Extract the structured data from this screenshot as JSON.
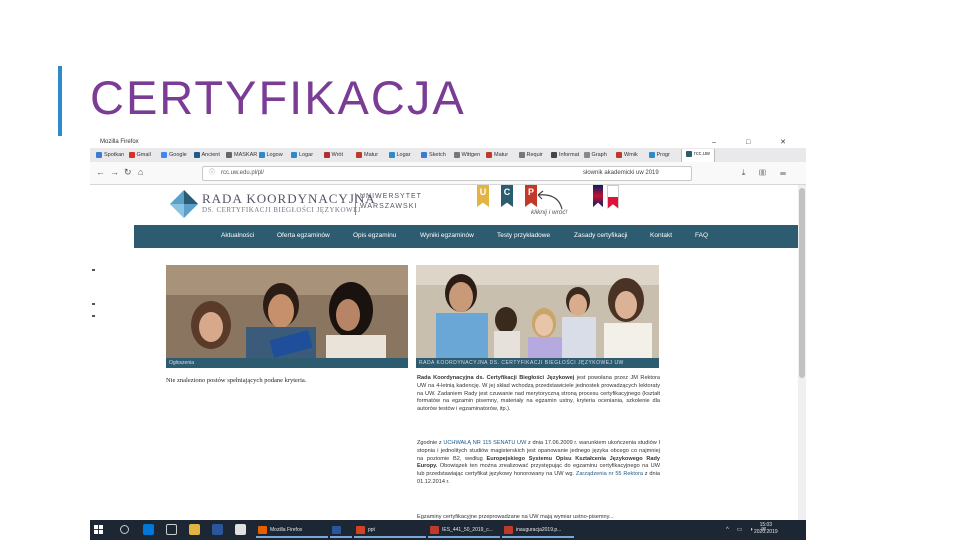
{
  "slide": {
    "title": "CERTYFIKACJA"
  },
  "window": {
    "title": "Mozilla Firefox",
    "controls": "–  □  ✕"
  },
  "tabs": [
    {
      "label": "Spotkan",
      "color": "#3a7bd5"
    },
    {
      "label": "Gmail",
      "color": "#d93025"
    },
    {
      "label": "Google",
      "color": "#4285f4"
    },
    {
      "label": "Ancient",
      "color": "#1e5a8a"
    },
    {
      "label": "MASKAR",
      "color": "#666666"
    },
    {
      "label": "Logow",
      "color": "#2e8bc9"
    },
    {
      "label": "Logar",
      "color": "#2e8bc9"
    },
    {
      "label": "Wrót",
      "color": "#b03030"
    },
    {
      "label": "Matur",
      "color": "#c0392b"
    },
    {
      "label": "Logar",
      "color": "#2e8bc9"
    },
    {
      "label": "Sketch",
      "color": "#3a7bd5"
    },
    {
      "label": "Wittgen",
      "color": "#777777"
    },
    {
      "label": "Matur",
      "color": "#c0392b"
    },
    {
      "label": "Requir",
      "color": "#777777"
    },
    {
      "label": "Informat",
      "color": "#444444"
    },
    {
      "label": "Graph",
      "color": "#888888"
    },
    {
      "label": "Wmik",
      "color": "#c0392b"
    },
    {
      "label": "Progr",
      "color": "#2e8bc9"
    },
    {
      "label": "rcc.uw",
      "color": "#2d5b70"
    }
  ],
  "urlbar": {
    "url": "rcc.uw.edu.pl/pl/",
    "search": "słownik akademicki uw 2019"
  },
  "site": {
    "logo_line1": "RADA KOORDYNACYJNA",
    "logo_line2": "DS. CERTYFIKACJI BIEGŁOŚCI JĘZYKOWEJ",
    "uw_line1": "UNIWERSYTET",
    "uw_line2": "WARSZAWSKI",
    "bookmarks": [
      {
        "letter": "U",
        "color": "#e2b441"
      },
      {
        "letter": "C",
        "color": "#2d5b70"
      },
      {
        "letter": "P",
        "color": "#c0392b"
      }
    ],
    "handwritten": "kliknij i wróć!",
    "nav": [
      "Aktualności",
      "Oferta egzaminów",
      "Opis egzaminu",
      "Wyniki egzaminów",
      "Testy przykładowe",
      "Zasady certyfikacji",
      "Kontakt",
      "FAQ"
    ],
    "caption_left": "Ogłoszenia",
    "caption_right": "RADA KOORDYNACYJNA DS. CERTYFIKACJI BIEGŁOŚCI JĘZYKOWEJ UW",
    "no_results": "Nie znaleziono postów spełniających podane kryteria.",
    "para1_bold": "Rada Koordynacyjna ds. Certyfikacji Biegłości Językowej",
    "para1_rest": " jest powołana przez JM Rektora UW na 4-letnią kadencję. W jej skład wchodzą przedstawiciele jednostek prowadzących lektoraty na UW. Zadaniem Rady jest czuwanie nad merytoryczną stroną procesu certyfikacyjnego (kształt formatów na egzamin pisemny, materiały na egzamin ustny, kryteria oceniania, szkolenie dla autorów testów i egzaminatorów, itp.).",
    "para2_a": "Zgodnie z ",
    "para2_link": "UCHWAŁĄ NR 115 SENATU UW",
    "para2_b": " z dnia 17.06.2009 r. warunkiem ukończenia studiów I stopnia i jednolitych studiów magisterskich jest opanowanie jednego języka obcego co najmniej na poziomie B2, według ",
    "para2_bold": "Europejskiego Systemu Opisu Kształcenia Językowego Rady Europy.",
    "para2_c": " Obowiązek ten można zrealizować przystępując do egzaminu certyfikacyjnego na UW lub przedstawiając certyfikat językowy honorowany na UW wg. ",
    "para2_link2": "Zarządzenia nr 55 Rektora",
    "para2_d": " z dnia 01.12.2014 r.",
    "para3": "Egzaminy certyfikacyjne przeprowadzane na UW mają wymiar ustno-pisemny..."
  },
  "taskbar": {
    "apps": [
      {
        "label": "Mozilla Firefox",
        "color": "#e66000"
      },
      {
        "label": "",
        "color": "#2b579a"
      },
      {
        "label": "ppt",
        "color": "#d04423"
      },
      {
        "label": "IES_441_50_2019_c...",
        "color": "#c0392b"
      },
      {
        "label": "inauguracja2019.p...",
        "color": "#c0392b"
      }
    ],
    "time": "15:03",
    "date": "2020.2019"
  }
}
